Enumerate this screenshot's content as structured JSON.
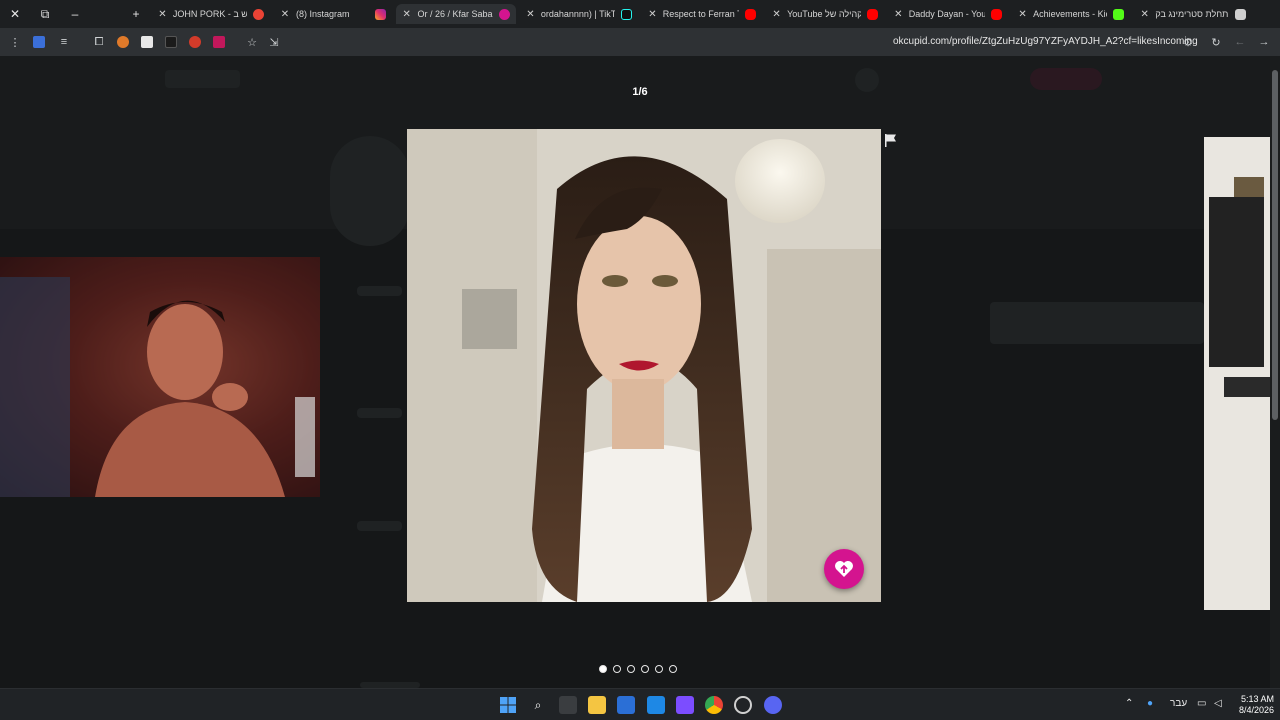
{
  "tabs": [
    {
      "title": "JOHN PORK - שוש ב",
      "favicon_color": "#ea4335",
      "active": false
    },
    {
      "title": "(8) Instagram",
      "favicon_color": "#e1306c",
      "active": false
    },
    {
      "title": "Or / 26 / Kfar Saba |",
      "favicon_color": "#d4148f",
      "active": true
    },
    {
      "title": "ordahannnn) | TikTok",
      "favicon_color": "#111111",
      "active": false
    },
    {
      "title": "Respect to Ferran Tor",
      "favicon_color": "#ff0000",
      "active": false
    },
    {
      "title": "YouTube הקהילה של",
      "favicon_color": "#ff0000",
      "active": false
    },
    {
      "title": "Daddy Dayan - YouTu",
      "favicon_color": "#ff0000",
      "active": false
    },
    {
      "title": "Achievements - Kick",
      "favicon_color": "#53fc18",
      "active": false
    },
    {
      "title": "התחלת סטרימינג בק",
      "favicon_color": "#cfcfcf",
      "active": false
    }
  ],
  "toolbar": {
    "url": "okcupid.com/profile/ZtgZuHzUg97YZFyAYDJH_A2?cf=likesIncoming"
  },
  "gallery": {
    "counter": "1/6",
    "total_photos": 6,
    "current_index": 1
  },
  "taskbar": {
    "lang": "עבר",
    "time": "5:13 AM",
    "date": "8/4/2026"
  }
}
